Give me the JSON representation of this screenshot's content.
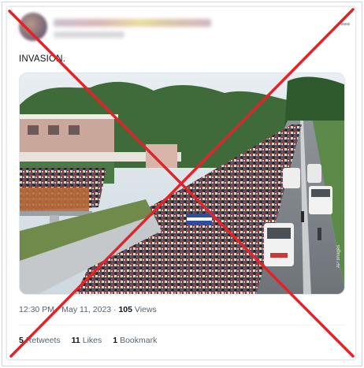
{
  "tweet": {
    "text": "INVASION.",
    "timestamp": "12:30 PM · May 11, 2023 · ",
    "views_count": "105",
    "views_label": "Views"
  },
  "stats": [
    {
      "count": "5",
      "label": "Retweets"
    },
    {
      "count": "11",
      "label": "Likes"
    },
    {
      "count": "1",
      "label": "Bookmark"
    }
  ],
  "photo": {
    "credit": "AP Images"
  },
  "icons": {
    "more": "more-options-icon",
    "overlay": "red-x-overlay"
  },
  "colors": {
    "overlay_red": "#e2232a",
    "meta_gray": "#536471"
  }
}
